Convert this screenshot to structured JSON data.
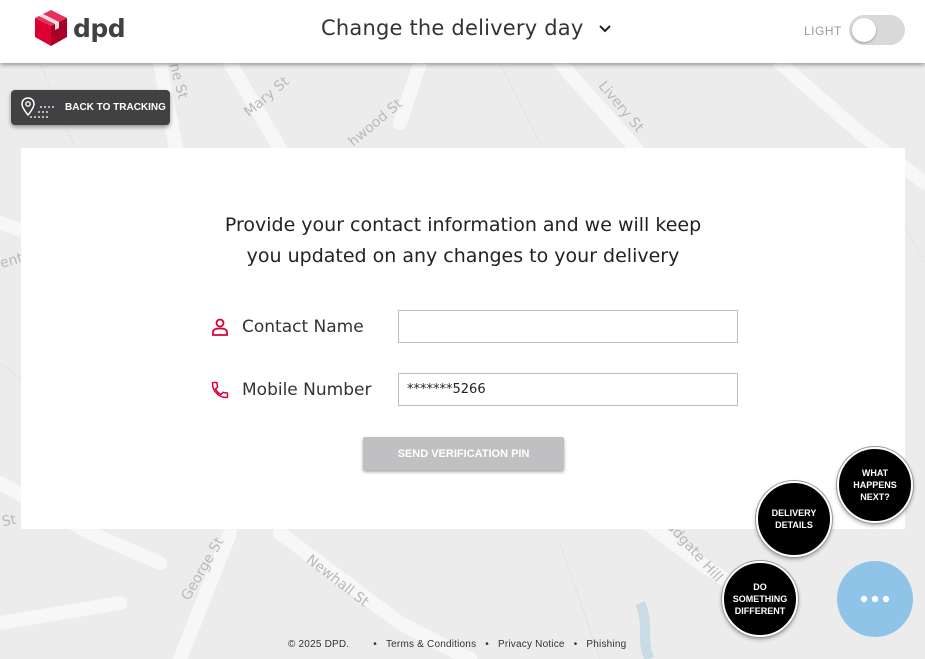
{
  "header": {
    "logo_text": "dpd",
    "title": "Change the delivery day",
    "theme_label": "LIGHT"
  },
  "back_button": {
    "label": "BACK TO TRACKING"
  },
  "map": {
    "streets": [
      "Mary St",
      "Livery St",
      "hwood St",
      "ne St",
      "ent",
      "St",
      "George St",
      "Newhall St",
      "Ludgate Hill"
    ]
  },
  "form": {
    "intro_line1": "Provide your contact information and we will keep",
    "intro_line2": "you updated on any changes to your delivery",
    "contact_name": {
      "label": "Contact Name",
      "value": ""
    },
    "mobile_number": {
      "label": "Mobile Number",
      "value": "*******5266"
    },
    "send_button": "SEND VERIFICATION PIN"
  },
  "actions": {
    "what_happens_next": "WHAT HAPPENS NEXT?",
    "delivery_details": "DELIVERY DETAILS",
    "do_something_different": "DO SOMETHING DIFFERENT",
    "menu_icon": "more-dots-icon"
  },
  "footer": {
    "copyright": "© 2025 DPD.",
    "links": [
      "Terms & Conditions",
      "Privacy Notice",
      "Phishing"
    ]
  },
  "colors": {
    "brand_red": "#dc0032",
    "dark_grey": "#414042",
    "fab_blue": "#8fc3e8",
    "disabled_button": "#c0c0c2"
  }
}
